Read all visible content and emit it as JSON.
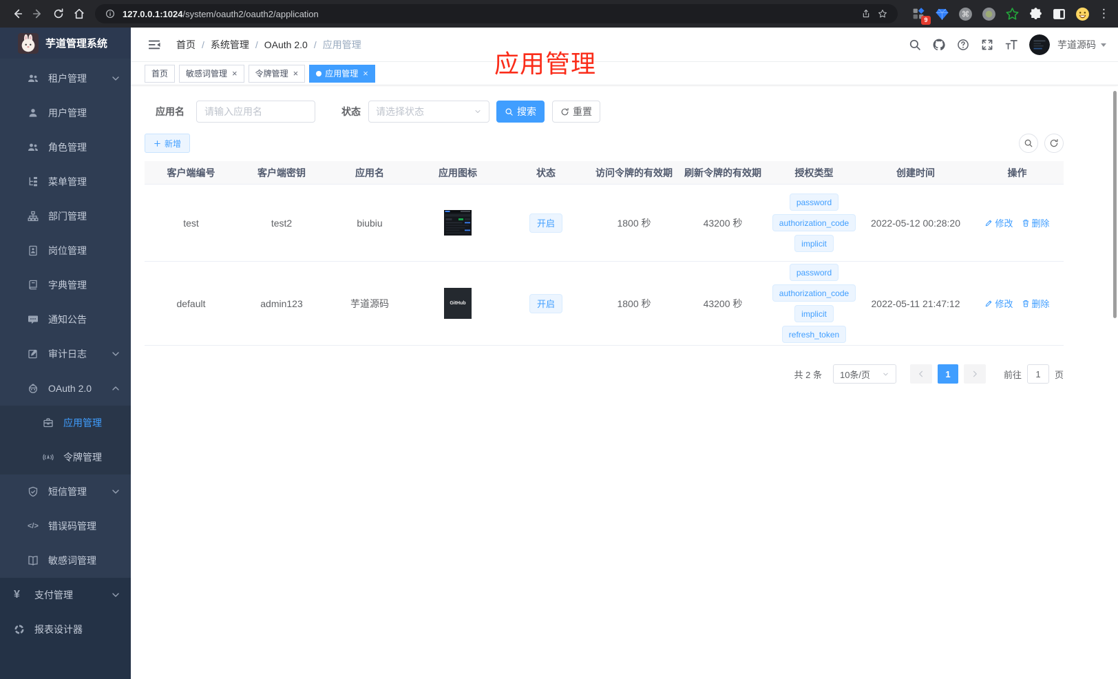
{
  "colors": {
    "accent": "#409eff",
    "annotation_red": "#fa2c19",
    "sidebar_bg": "#2f3d53",
    "sidebar_dark_bg": "#243246",
    "tag_bg": "#ecf5ff",
    "table_header_bg": "#f8f8f9"
  },
  "browser": {
    "url_host": "127.0.0.1:1024",
    "url_path": "/system/oauth2/oauth2/application",
    "extensions_badge": "9",
    "extensions": [
      "apps-grid",
      "gem",
      "command",
      "record",
      "green-star",
      "puzzle",
      "split-view",
      "emoji"
    ]
  },
  "sidebar": {
    "title": "芋道管理系统",
    "items": [
      {
        "label": "租户管理",
        "icon": "users",
        "arrow": "down"
      },
      {
        "label": "用户管理",
        "icon": "user"
      },
      {
        "label": "角色管理",
        "icon": "users"
      },
      {
        "label": "菜单管理",
        "icon": "menu-tree"
      },
      {
        "label": "部门管理",
        "icon": "org"
      },
      {
        "label": "岗位管理",
        "icon": "badge"
      },
      {
        "label": "字典管理",
        "icon": "dict"
      },
      {
        "label": "通知公告",
        "icon": "message"
      },
      {
        "label": "审计日志",
        "icon": "audit",
        "arrow": "down"
      },
      {
        "label": "OAuth 2.0",
        "icon": "robot",
        "arrow": "up"
      },
      {
        "label": "应用管理",
        "icon": "briefcase",
        "level": "child",
        "active": true
      },
      {
        "label": "令牌管理",
        "icon": "signal",
        "level": "child"
      },
      {
        "label": "短信管理",
        "icon": "shield",
        "arrow": "down"
      },
      {
        "label": "错误码管理",
        "icon": "code"
      },
      {
        "label": "敏感词管理",
        "icon": "open-book"
      },
      {
        "label": "支付管理",
        "icon": "yen",
        "arrow": "down",
        "level": "root"
      },
      {
        "label": "报表设计器",
        "icon": "report",
        "level": "root"
      }
    ]
  },
  "navbar": {
    "breadcrumb": [
      "首页",
      "系统管理",
      "OAuth 2.0",
      "应用管理"
    ],
    "username": "芋道源码"
  },
  "annotation": "应用管理",
  "tabs": [
    {
      "label": "首页",
      "closable": false,
      "active": false
    },
    {
      "label": "敏感词管理",
      "closable": true,
      "active": false
    },
    {
      "label": "令牌管理",
      "closable": true,
      "active": false
    },
    {
      "label": "应用管理",
      "closable": true,
      "active": true
    }
  ],
  "filters": {
    "name_label": "应用名",
    "name_placeholder": "请输入应用名",
    "status_label": "状态",
    "status_placeholder": "请选择状态",
    "search_label": "搜索",
    "reset_label": "重置"
  },
  "toolbar": {
    "add_label": "新增"
  },
  "table": {
    "headers": [
      "客户端编号",
      "客户端密钥",
      "应用名",
      "应用图标",
      "状态",
      "访问令牌的有效期",
      "刷新令牌的有效期",
      "授权类型",
      "创建时间",
      "操作"
    ],
    "edit_label": "修改",
    "delete_label": "删除",
    "rows": [
      {
        "client_id": "test",
        "secret": "test2",
        "name": "biubiu",
        "icon": "screenshot-thumb",
        "icon_text": "",
        "status": "开启",
        "access_ttl": "1800 秒",
        "refresh_ttl": "43200 秒",
        "grants": [
          "password",
          "authorization_code",
          "implicit"
        ],
        "created": "2022-05-12 00:28:20"
      },
      {
        "client_id": "default",
        "secret": "admin123",
        "name": "芋道源码",
        "icon": "github-thumb",
        "icon_text": "GitHub",
        "status": "开启",
        "access_ttl": "1800 秒",
        "refresh_ttl": "43200 秒",
        "grants": [
          "password",
          "authorization_code",
          "implicit",
          "refresh_token"
        ],
        "created": "2022-05-11 21:47:12"
      }
    ]
  },
  "pagination": {
    "total": "共 2 条",
    "page_size": "10条/页",
    "current_page": "1",
    "goto_prefix": "前往",
    "goto_suffix": "页",
    "goto_value": "1"
  }
}
